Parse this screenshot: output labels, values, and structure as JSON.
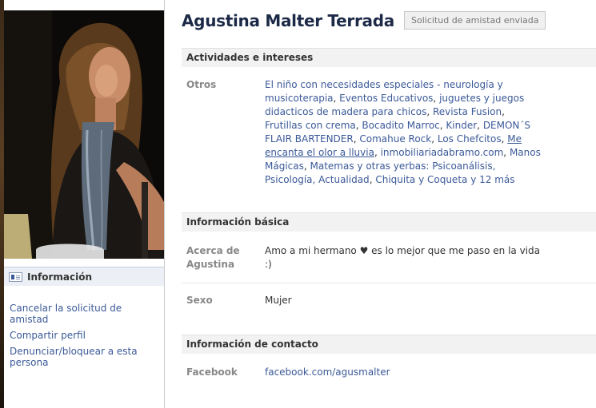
{
  "profile": {
    "name": "Agustina Malter Terrada",
    "friend_request_button": "Solicitud de amistad enviada"
  },
  "left_panel": {
    "info_tab": "Información",
    "links": [
      "Cancelar la solicitud de amistad",
      "Compartir perfil",
      "Denunciar/bloquear a esta persona"
    ]
  },
  "sections": {
    "activities": {
      "title": "Actividades e intereses",
      "others_label": "Otros",
      "items": [
        "El niño con necesidades especiales - neurología y musicoterapia",
        "Eventos Educativos",
        "juguetes y juegos didacticos de madera para chicos",
        "Revista Fusion",
        "Frutillas con crema",
        "Bocadito Marroc",
        "Kinder",
        "DEMON´S FLAIR BARTENDER",
        "Comahue Rock",
        "Los Chefcitos",
        "Me encanta el olor a lluvia",
        "inmobiliariadabramo.com",
        "Manos Mágicas",
        "Matemas y otras yerbas: Psicoanálisis, Psicología, Actualidad",
        "Chiquita y Coqueta"
      ],
      "more": "y 12 más"
    },
    "basic": {
      "title": "Información básica",
      "about_label": "Acerca de Agustina",
      "about_value": "Amo a mi hermano ♥ es lo mejor que me paso en la vida :)",
      "sex_label": "Sexo",
      "sex_value": "Mujer"
    },
    "contact": {
      "title": "Información de contacto",
      "facebook_label": "Facebook",
      "facebook_value": "facebook.com/agusmalter"
    }
  },
  "colors": {
    "link": "#3b5998",
    "header_bg": "#f2f2f2",
    "name": "#1c2a47"
  }
}
